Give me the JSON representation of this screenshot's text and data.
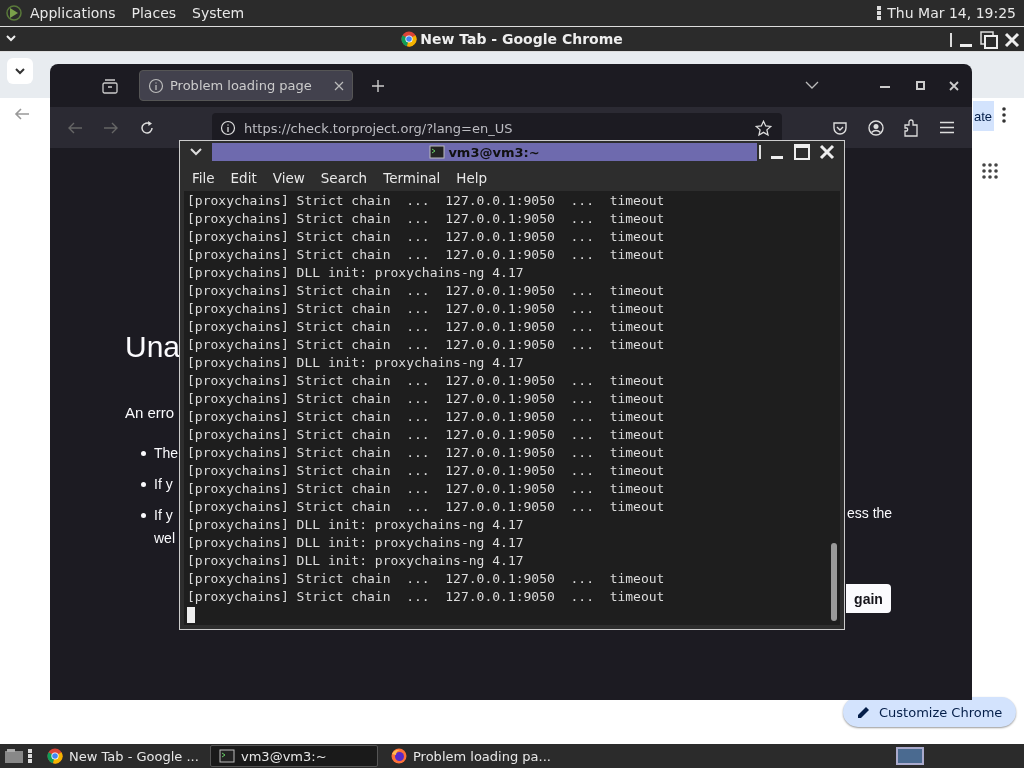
{
  "top_panel": {
    "menus": [
      "Applications",
      "Places",
      "System"
    ],
    "clock": "Thu Mar 14, 19:25"
  },
  "chrome_window": {
    "title": "New Tab - Google Chrome",
    "partial_button": "ate",
    "customize_button": "Customize Chrome"
  },
  "firefox_window": {
    "tabs": [
      {
        "title": "Problem loading page",
        "selected": true
      }
    ],
    "url": "https://check.torproject.org/?lang=en_US",
    "page": {
      "heading": "Una",
      "intro": "An erro",
      "bullets": [
        [
          "The"
        ],
        [
          "If y"
        ],
        [
          "If y",
          "wel"
        ]
      ],
      "right_text": "ess the",
      "button": "gain"
    }
  },
  "terminal_window": {
    "title": "vm3@vm3:~",
    "menus": [
      "File",
      "Edit",
      "View",
      "Search",
      "Terminal",
      "Help"
    ],
    "lines": [
      "[proxychains] Strict chain  ...  127.0.0.1:9050  ...  timeout",
      "[proxychains] Strict chain  ...  127.0.0.1:9050  ...  timeout",
      "[proxychains] Strict chain  ...  127.0.0.1:9050  ...  timeout",
      "[proxychains] Strict chain  ...  127.0.0.1:9050  ...  timeout",
      "[proxychains] DLL init: proxychains-ng 4.17",
      "[proxychains] Strict chain  ...  127.0.0.1:9050  ...  timeout",
      "[proxychains] Strict chain  ...  127.0.0.1:9050  ...  timeout",
      "[proxychains] Strict chain  ...  127.0.0.1:9050  ...  timeout",
      "[proxychains] Strict chain  ...  127.0.0.1:9050  ...  timeout",
      "[proxychains] DLL init: proxychains-ng 4.17",
      "[proxychains] Strict chain  ...  127.0.0.1:9050  ...  timeout",
      "[proxychains] Strict chain  ...  127.0.0.1:9050  ...  timeout",
      "[proxychains] Strict chain  ...  127.0.0.1:9050  ...  timeout",
      "[proxychains] Strict chain  ...  127.0.0.1:9050  ...  timeout",
      "[proxychains] Strict chain  ...  127.0.0.1:9050  ...  timeout",
      "[proxychains] Strict chain  ...  127.0.0.1:9050  ...  timeout",
      "[proxychains] Strict chain  ...  127.0.0.1:9050  ...  timeout",
      "[proxychains] Strict chain  ...  127.0.0.1:9050  ...  timeout",
      "[proxychains] DLL init: proxychains-ng 4.17",
      "[proxychains] DLL init: proxychains-ng 4.17",
      "[proxychains] DLL init: proxychains-ng 4.17",
      "[proxychains] Strict chain  ...  127.0.0.1:9050  ...  timeout",
      "[proxychains] Strict chain  ...  127.0.0.1:9050  ...  timeout"
    ]
  },
  "taskbar": {
    "items": [
      {
        "label": "New Tab - Google ...",
        "kind": "chrome",
        "selected": false
      },
      {
        "label": "vm3@vm3:~",
        "kind": "terminal",
        "selected": true
      },
      {
        "label": "Problem loading pa...",
        "kind": "firefox",
        "selected": false
      }
    ],
    "workspaces": [
      {
        "selected": true
      }
    ]
  }
}
